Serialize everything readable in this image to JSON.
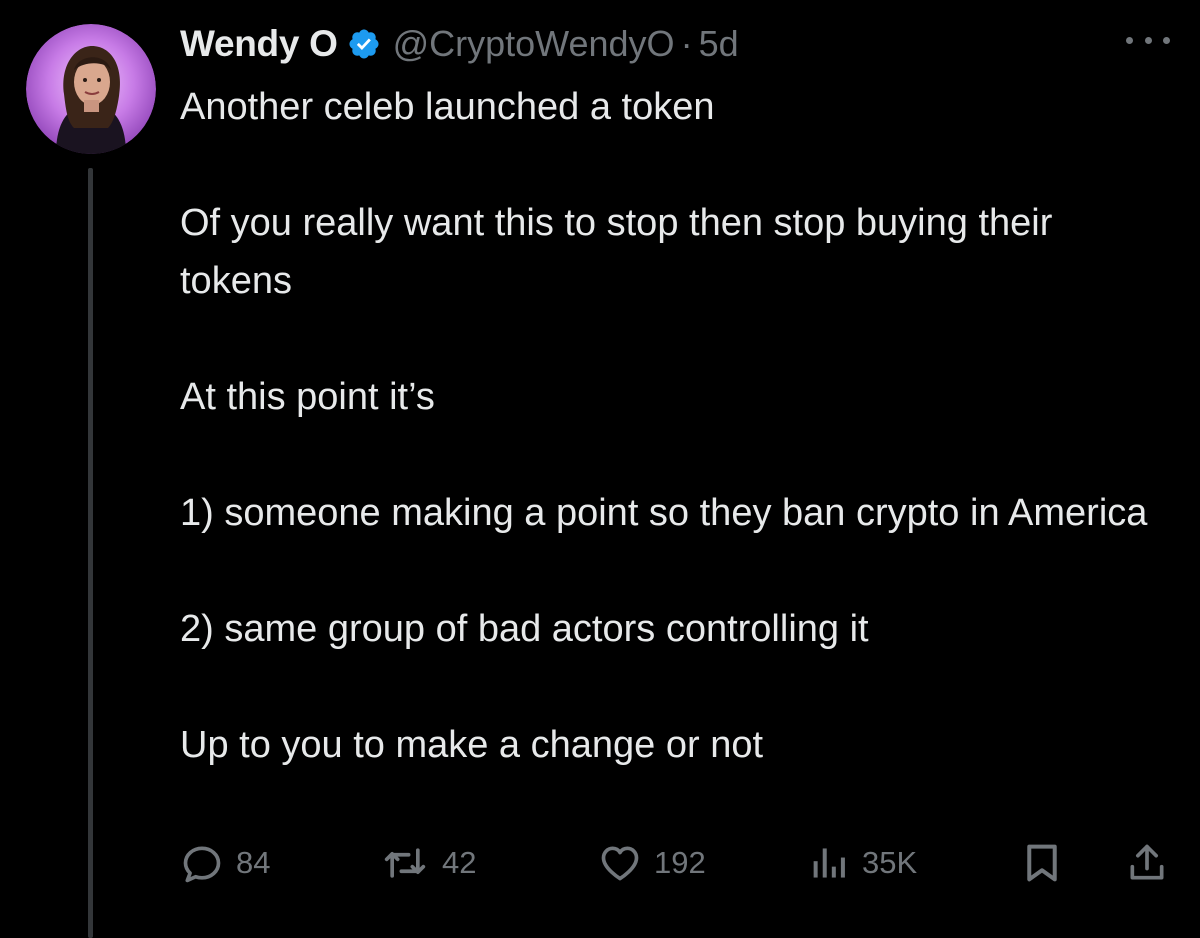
{
  "author": {
    "display_name": "Wendy O",
    "handle": "@CryptoWendyO",
    "time_separator": "·",
    "timestamp": "5d",
    "verified": true
  },
  "tweet": {
    "paragraphs": [
      "Another celeb launched a token",
      "Of you really want this to stop then stop buying their tokens",
      "At this point it’s",
      "1) someone making a point so they ban crypto in America",
      "2) same group of bad actors controlling it",
      "Up to you to make a change or not"
    ]
  },
  "actions": {
    "replies": "84",
    "reposts": "42",
    "likes": "192",
    "views": "35K"
  },
  "icons": {
    "verified": "verified-badge-icon",
    "more": "more-icon",
    "reply": "reply-icon",
    "repost": "repost-icon",
    "like": "heart-icon",
    "views": "views-icon",
    "bookmark": "bookmark-icon",
    "share": "share-icon"
  },
  "colors": {
    "background": "#000000",
    "text_primary": "#e7e9ea",
    "text_secondary": "#71767b",
    "verified_blue": "#1d9bf0",
    "avatar_ring": "#c878e6"
  }
}
